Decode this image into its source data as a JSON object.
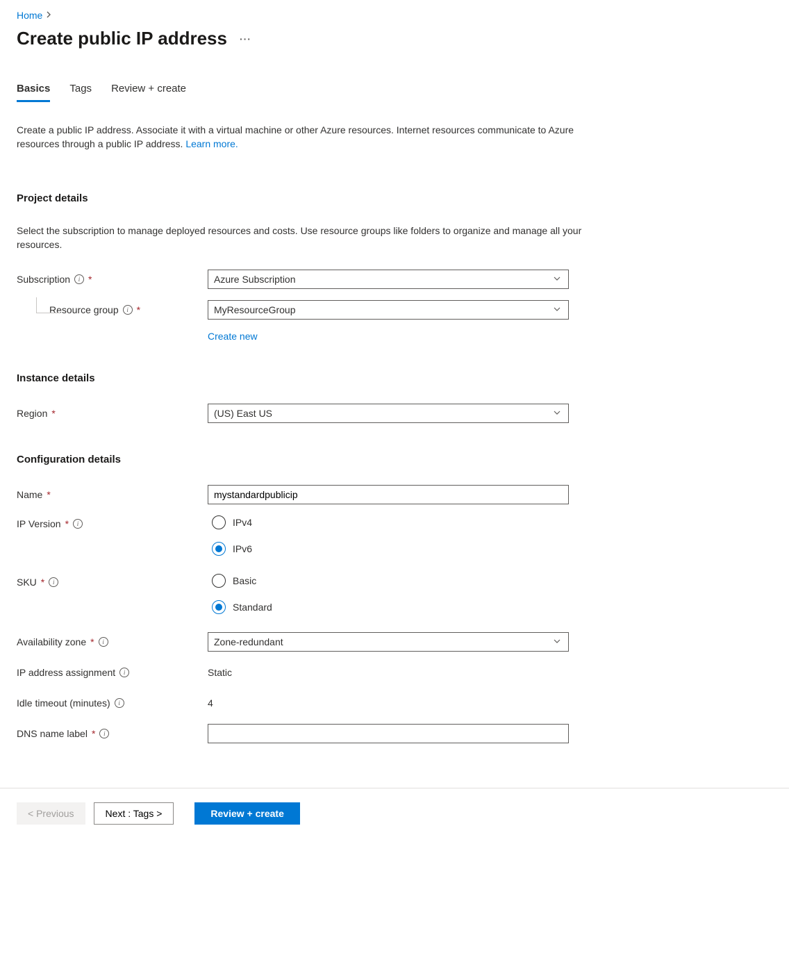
{
  "breadcrumb": {
    "home": "Home"
  },
  "title": "Create public IP address",
  "tabs": {
    "basics": "Basics",
    "tags": "Tags",
    "review": "Review + create"
  },
  "description": "Create a public IP address. Associate it with a virtual machine or other Azure resources. Internet resources communicate to Azure resources through a public IP address. ",
  "description_link": "Learn more.",
  "project": {
    "header": "Project details",
    "desc": "Select the subscription to manage deployed resources and costs. Use resource groups like folders to organize and manage all your resources.",
    "subscription_label": "Subscription",
    "subscription_value": "Azure Subscription",
    "rg_label": "Resource group",
    "rg_value": "MyResourceGroup",
    "create_new": "Create new"
  },
  "instance": {
    "header": "Instance details",
    "region_label": "Region",
    "region_value": "(US) East US"
  },
  "config": {
    "header": "Configuration details",
    "name_label": "Name",
    "name_value": "mystandardpublicip",
    "ipver_label": "IP Version",
    "ipv4": "IPv4",
    "ipv6": "IPv6",
    "sku_label": "SKU",
    "sku_basic": "Basic",
    "sku_standard": "Standard",
    "az_label": "Availability zone",
    "az_value": "Zone-redundant",
    "assign_label": "IP address assignment",
    "assign_value": "Static",
    "idle_label": "Idle timeout (minutes)",
    "idle_value": "4",
    "dns_label": "DNS name label",
    "dns_value": ""
  },
  "footer": {
    "prev": "< Previous",
    "next": "Next : Tags >",
    "review": "Review + create"
  }
}
